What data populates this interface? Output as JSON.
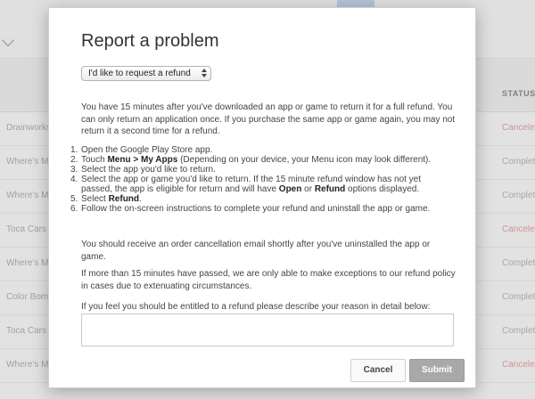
{
  "background": {
    "status_header": "STATUS",
    "rows": [
      {
        "name": "Drainworks",
        "status": "Cancelec",
        "status_type": "cancelled"
      },
      {
        "name": "Where's My",
        "status": "Complete",
        "status_type": "complete"
      },
      {
        "name": "Where's My",
        "status": "Complete",
        "status_type": "complete"
      },
      {
        "name": "Toca Cars",
        "status": "Cancelec",
        "status_type": "cancelled"
      },
      {
        "name": "Where's My",
        "status": "Complete",
        "status_type": "complete"
      },
      {
        "name": "Color Bomb",
        "status": "Complete",
        "status_type": "complete"
      },
      {
        "name": "Toca Cars",
        "status": "Complete",
        "status_type": "complete"
      },
      {
        "name": "Where's M",
        "status": "Cancelec",
        "status_type": "cancelled"
      }
    ]
  },
  "dialog": {
    "title": "Report a problem",
    "select_value": "I'd like to request a refund",
    "intro": "You have 15 minutes after you've downloaded an app or game to return it for a full refund. You can only return an application once. If you purchase the same app or game again, you may not return it a second time for a refund.",
    "steps": {
      "n1": "1.",
      "s1": "Open the Google Play Store app.",
      "n2": "2.",
      "s2_a": "Touch ",
      "s2_menu": "Menu",
      "s2_b": " > ",
      "s2_myapps": "My Apps",
      "s2_c": " (Depending on your device, your Menu icon may look different).",
      "n3": "3.",
      "s3": "Select the app you'd like to return.",
      "n4": "4.",
      "s4_a": "Select the app or game you'd like to return. If the 15 minute refund window has not yet passed, the app is eligible for return and will have ",
      "s4_open": "Open",
      "s4_b": " or ",
      "s4_refund": "Refund",
      "s4_c": " options displayed.",
      "n5": "5.",
      "s5_a": "Select ",
      "s5_refund": "Refund",
      "s5_b": ".",
      "n6": "6.",
      "s6": "Follow the on-screen instructions to complete your refund and uninstall the app or game."
    },
    "email_note": "You should receive an order cancellation email shortly after you've uninstalled the app or game.",
    "exception_note": "If more than 15 minutes have passed, we are only able to make exceptions to our refund policy in cases due to extenuating circumstances.",
    "reason_prompt": "If you feel you should be entitled to a refund please describe your reason in detail below:",
    "reason_value": "",
    "cancel_label": "Cancel",
    "submit_label": "Submit"
  },
  "colors": {
    "submit_bg": "#a8a8a8",
    "cancelled_status": "#e3a3a3"
  }
}
